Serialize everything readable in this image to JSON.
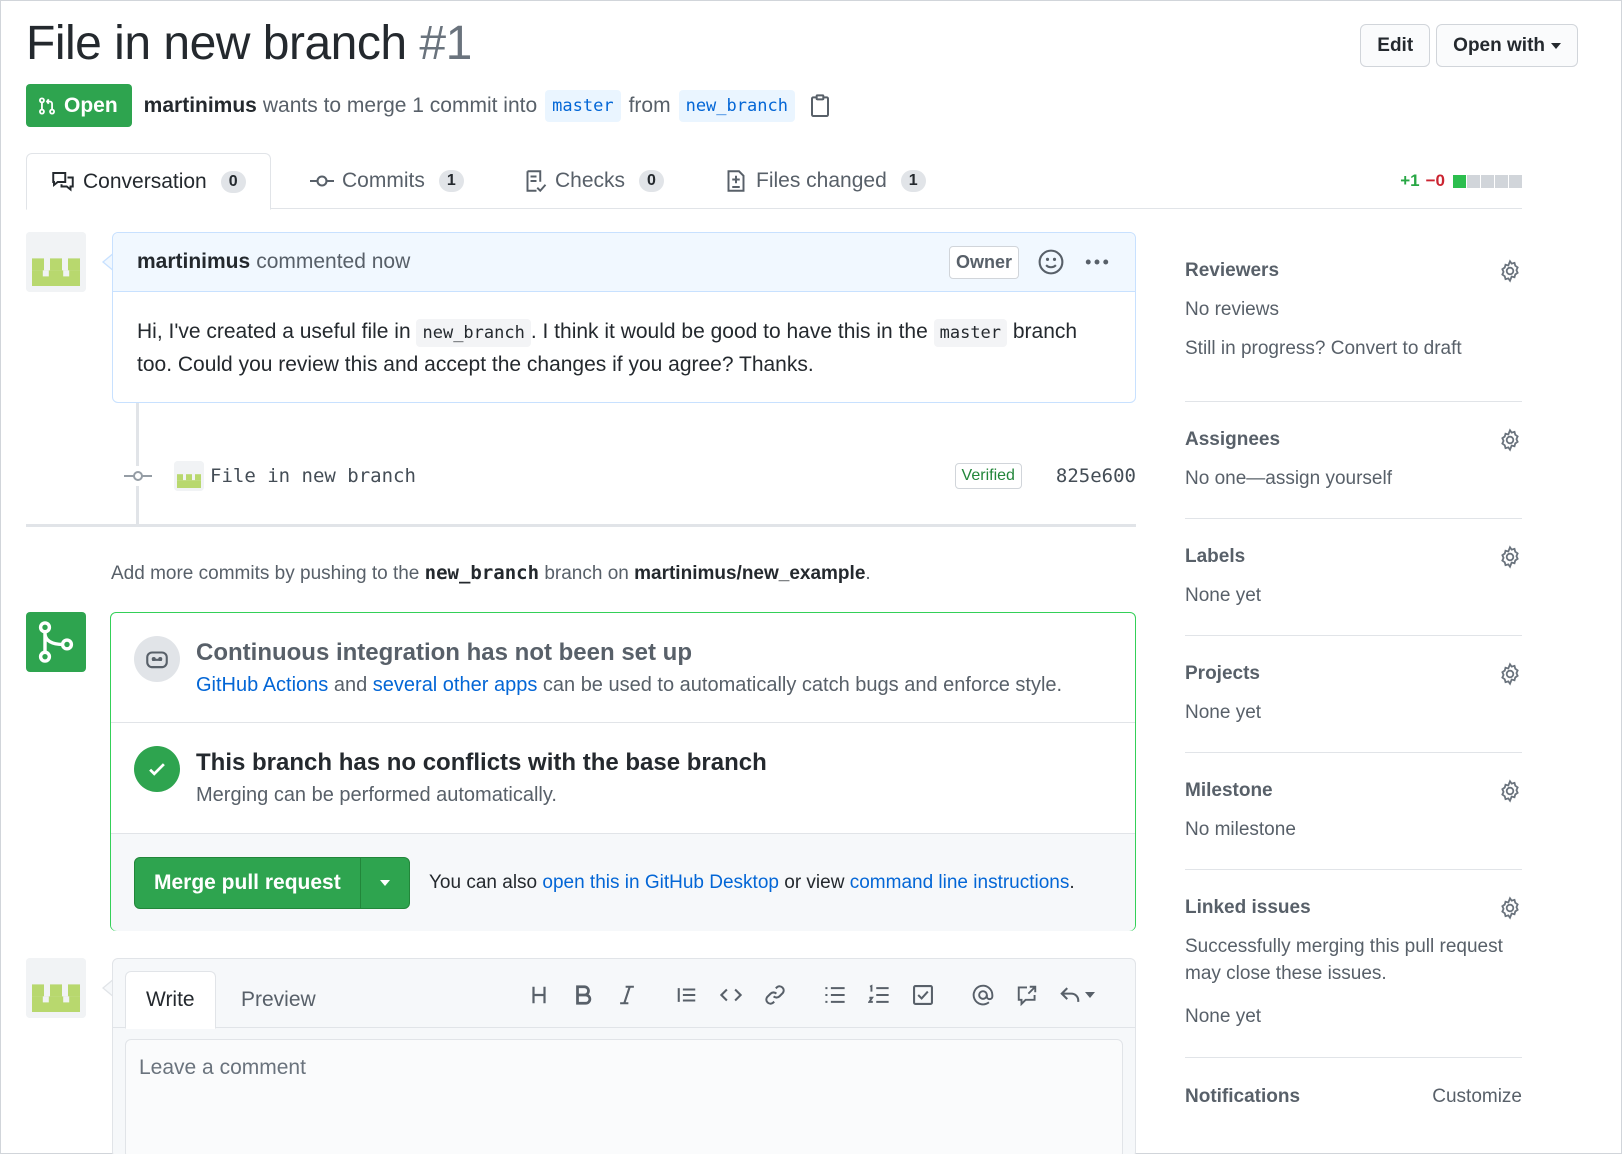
{
  "header": {
    "title": "File in new branch",
    "number": "#1",
    "edit_label": "Edit",
    "open_with_label": "Open with"
  },
  "meta": {
    "state": "Open",
    "author": "martinimus",
    "wants_to_merge": "wants to merge 1 commit into",
    "base_branch": "master",
    "from_label": "from",
    "head_branch": "new_branch"
  },
  "tabs": [
    {
      "label": "Conversation",
      "count": "0",
      "icon": "comment-discussion-icon"
    },
    {
      "label": "Commits",
      "count": "1",
      "icon": "git-commit-icon"
    },
    {
      "label": "Checks",
      "count": "0",
      "icon": "checklist-icon"
    },
    {
      "label": "Files changed",
      "count": "1",
      "icon": "diff-icon"
    }
  ],
  "diffstat": {
    "additions": "+1",
    "deletions": "−0"
  },
  "comment": {
    "author": "martinimus",
    "action": "commented now",
    "role": "Owner",
    "body_part1": "Hi, I've created a useful file in ",
    "code1": "new_branch",
    "body_part2": ". I think it would be good to have this in the ",
    "code2": "master",
    "body_part3": " branch too. Could you review this and accept the changes if you agree? Thanks."
  },
  "commit": {
    "message": "File in new branch",
    "verified": "Verified",
    "sha": "825e600"
  },
  "push_note": {
    "prefix": "Add more commits by pushing to the ",
    "branch": "new_branch",
    "middle": " branch on ",
    "repo": "martinimus/new_example",
    "suffix": "."
  },
  "merge": {
    "ci_title": "Continuous integration has not been set up",
    "ci_link1": "GitHub Actions",
    "ci_and": " and ",
    "ci_link2": "several other apps",
    "ci_rest": " can be used to automatically catch bugs and enforce style.",
    "conflict_title": "This branch has no conflicts with the base branch",
    "conflict_sub": "Merging can be performed automatically.",
    "button_label": "Merge pull request",
    "note_prefix": "You can also ",
    "note_link1": "open this in GitHub Desktop",
    "note_mid": " or view ",
    "note_link2": "command line instructions",
    "note_suffix": "."
  },
  "write": {
    "write_tab": "Write",
    "preview_tab": "Preview",
    "placeholder": "Leave a comment",
    "toolbar": [
      "heading-icon",
      "bold-icon",
      "italic-icon",
      "quote-icon",
      "code-icon",
      "link-icon",
      "unordered-list-icon",
      "ordered-list-icon",
      "task-list-icon",
      "mention-icon",
      "cross-reference-icon",
      "reply-icon"
    ]
  },
  "sidebar": {
    "reviewers": {
      "title": "Reviewers",
      "value": "No reviews",
      "note": "Still in progress? Convert to draft"
    },
    "assignees": {
      "title": "Assignees",
      "value": "No one—assign yourself"
    },
    "labels": {
      "title": "Labels",
      "value": "None yet"
    },
    "projects": {
      "title": "Projects",
      "value": "None yet"
    },
    "milestone": {
      "title": "Milestone",
      "value": "No milestone"
    },
    "linked_issues": {
      "title": "Linked issues",
      "note": "Successfully merging this pull request may close these issues.",
      "value": "None yet"
    },
    "notifications": {
      "title": "Notifications",
      "action": "Customize"
    }
  },
  "colors": {
    "accent_green": "#2ea44f",
    "link_blue": "#0366d6",
    "text": "#24292e",
    "muted": "#586069"
  }
}
